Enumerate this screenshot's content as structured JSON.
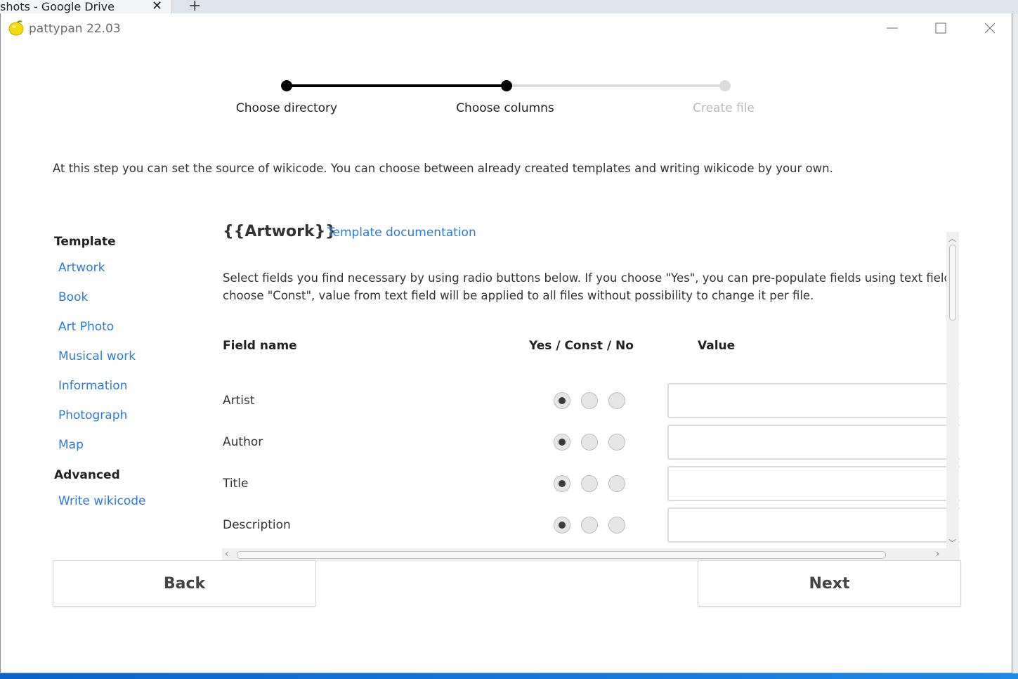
{
  "browser": {
    "tab_title": "shots - Google Drive",
    "close_glyph": "✕",
    "new_tab_glyph": "+"
  },
  "app": {
    "title": "pattypan 22.03",
    "logo_icon": "lemon-icon",
    "accent_color": "#2a7ae2"
  },
  "stepper": {
    "steps": [
      {
        "label": "Choose directory",
        "state": "done"
      },
      {
        "label": "Choose columns",
        "state": "current"
      },
      {
        "label": "Create file",
        "state": "pending"
      }
    ]
  },
  "intro_text": "At this step you can set the source of wikicode. You can choose between already created templates and writing wikicode by your own.",
  "nav": {
    "template_heading": "Template",
    "templates": [
      "Artwork",
      "Book",
      "Art Photo",
      "Musical work",
      "Information",
      "Photograph",
      "Map"
    ],
    "advanced_heading": "Advanced",
    "advanced_items": [
      "Write wikicode"
    ]
  },
  "content": {
    "template_title": "{{Artwork}}",
    "doc_link": "Template documentation",
    "description": "Select fields you find necessary by using radio buttons below. If you choose \"Yes\", you can pre-populate fields using text field. If you choose \"Const\", value from text field will be applied to all files without possibility to change it per file.",
    "columns": {
      "field": "Field name",
      "options": "Yes / Const / No",
      "value": "Value"
    },
    "fields": [
      {
        "name": "Artist",
        "selected": "yes",
        "value": ""
      },
      {
        "name": "Author",
        "selected": "yes",
        "value": ""
      },
      {
        "name": "Title",
        "selected": "yes",
        "value": ""
      },
      {
        "name": "Description",
        "selected": "yes",
        "value": ""
      }
    ]
  },
  "buttons": {
    "back": "Back",
    "next": "Next"
  }
}
